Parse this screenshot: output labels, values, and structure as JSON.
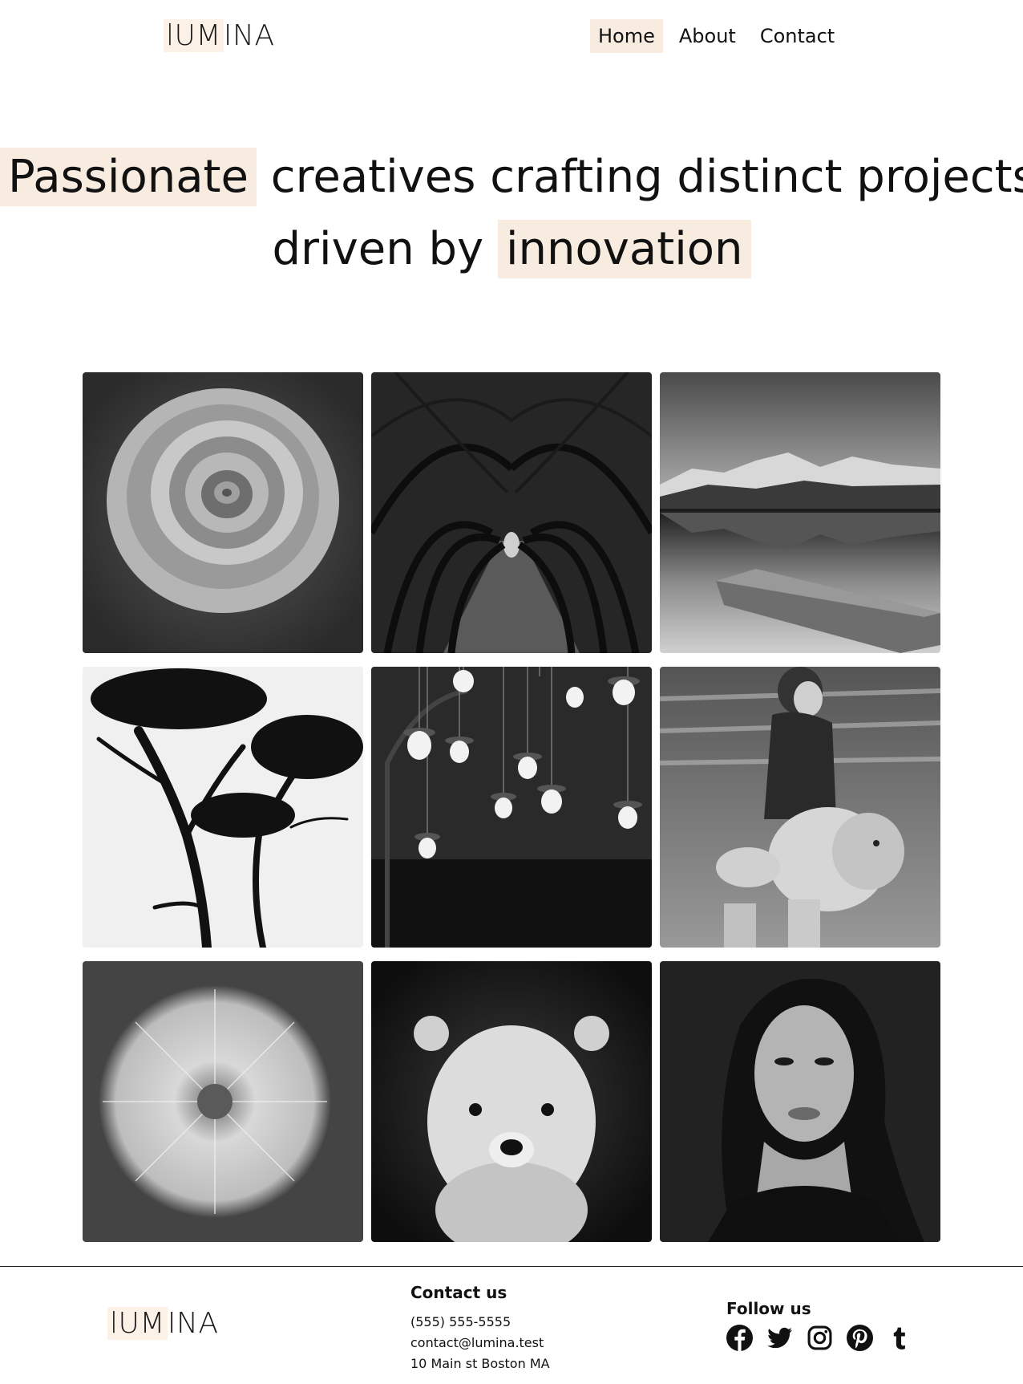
{
  "brand": {
    "logo_highlight": "lUM",
    "logo_rest": "INA"
  },
  "nav": {
    "home": "Home",
    "about": "About",
    "contact": "Contact"
  },
  "hero": {
    "highlight1": "Passionate",
    "text1": "creatives crafting distinct projects,",
    "text2": "driven by",
    "highlight2": "innovation"
  },
  "gallery": {
    "items": [
      {
        "icon": "rose-photo"
      },
      {
        "icon": "tree-tunnel-photo"
      },
      {
        "icon": "mountain-lake-photo"
      },
      {
        "icon": "trees-silhouette-photo"
      },
      {
        "icon": "hanging-bulbs-photo"
      },
      {
        "icon": "girl-with-teddy-photo"
      },
      {
        "icon": "dandelion-photo"
      },
      {
        "icon": "polar-bear-cub-photo"
      },
      {
        "icon": "woman-portrait-photo"
      }
    ]
  },
  "footer": {
    "contact_title": "Contact us",
    "phone": "(555) 555-5555",
    "email": "contact@lumina.test",
    "address": "10 Main st Boston MA",
    "follow_title": "Follow us",
    "social_icons": [
      "facebook-icon",
      "twitter-icon",
      "instagram-icon",
      "pinterest-icon",
      "tumblr-icon"
    ]
  },
  "colors": {
    "highlight": "#f8ece0",
    "text": "#111111",
    "background": "#ffffff"
  }
}
